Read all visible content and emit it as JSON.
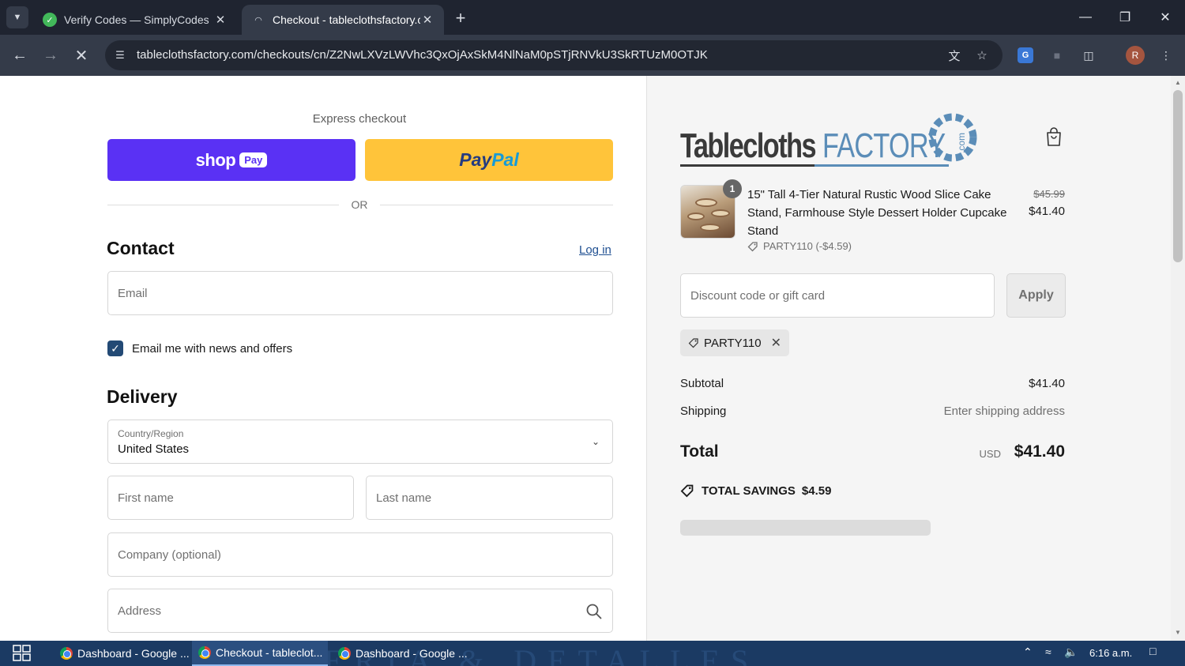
{
  "browser": {
    "tabs": [
      {
        "title": "Verify Codes — SimplyCodes",
        "active": false
      },
      {
        "title": "Checkout - tableclothsfactory.c",
        "active": true
      }
    ],
    "url": "tableclothsfactory.com/checkouts/cn/Z2NwLXVzLWVhc3QxOjAxSkM4NlNaM0pSTjRNVkU3SkRTUzM0OTJK"
  },
  "checkout": {
    "express_label": "Express checkout",
    "shop_pay": {
      "word": "shop",
      "pill": "Pay"
    },
    "paypal": {
      "part1": "Pay",
      "part2": "Pal"
    },
    "or_text": "OR",
    "contact": {
      "title": "Contact",
      "login_link": "Log in",
      "email_placeholder": "Email",
      "newsletter_label": "Email me with news and offers",
      "newsletter_checked": true
    },
    "delivery": {
      "title": "Delivery",
      "country_label": "Country/Region",
      "country_value": "United States",
      "first_name_placeholder": "First name",
      "last_name_placeholder": "Last name",
      "company_placeholder": "Company (optional)",
      "address_placeholder": "Address"
    }
  },
  "summary": {
    "brand": {
      "part1": "Tablecloths",
      "part2": "FACTORY",
      "suffix": ".com"
    },
    "item": {
      "quantity": "1",
      "name": "15\" Tall 4-Tier Natural Rustic Wood Slice Cake Stand, Farmhouse Style Dessert Holder Cupcake Stand",
      "discount": "PARTY110 (-$4.59)",
      "original_price": "$45.99",
      "price": "$41.40"
    },
    "discount_placeholder": "Discount code or gift card",
    "apply_label": "Apply",
    "applied_code": "PARTY110",
    "subtotal_label": "Subtotal",
    "subtotal_value": "$41.40",
    "shipping_label": "Shipping",
    "shipping_value": "Enter shipping address",
    "total_label": "Total",
    "total_currency": "USD",
    "total_value": "$41.40",
    "savings_label": "TOTAL SAVINGS",
    "savings_value": "$4.59"
  },
  "taskbar": {
    "items": [
      {
        "label": "Dashboard - Google ...",
        "active": false
      },
      {
        "label": "Checkout - tableclot...",
        "active": true
      },
      {
        "label": "Dashboard - Google ...",
        "active": false
      }
    ],
    "wallpaper_text": "ERIA & DETALLES",
    "time": "6:16 a.m."
  },
  "colors": {
    "shop_pay": "#5a31f4",
    "paypal": "#ffc43a",
    "checkbox": "#234a75",
    "link": "#1f4f91",
    "brand_blue": "#5b8db8"
  }
}
